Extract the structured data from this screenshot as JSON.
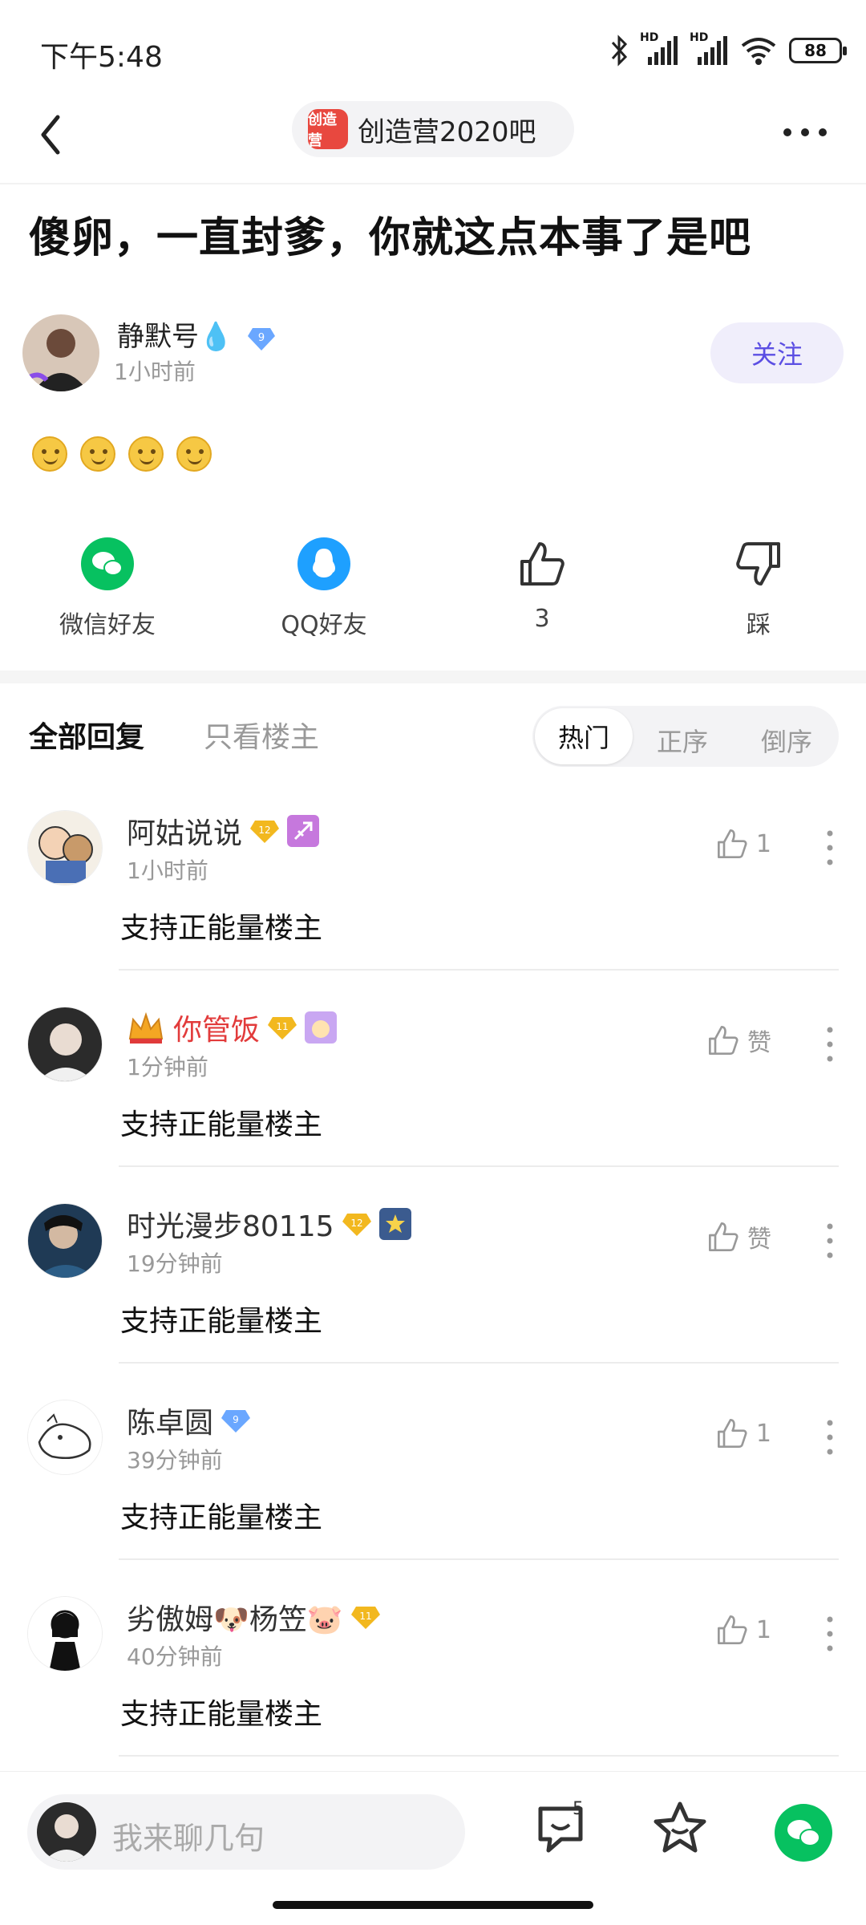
{
  "status_bar": {
    "time": "下午5:48",
    "battery": "88",
    "net1": "HD",
    "net2": "HD"
  },
  "nav": {
    "forum_name": "创造营2020吧",
    "forum_logo_text": "创造营"
  },
  "post": {
    "title": "傻卵，一直封爹，你就这点本事了是吧",
    "author": {
      "name": "静默号💧",
      "level": "9",
      "time": "1小时前"
    },
    "follow_label": "关注"
  },
  "actions": {
    "wechat": "微信好友",
    "qq": "QQ好友",
    "like_count": "3",
    "dislike": "踩"
  },
  "reply_tabs": {
    "all": "全部回复",
    "op_only": "只看楼主",
    "sort": {
      "hot": "热门",
      "asc": "正序",
      "desc": "倒序"
    }
  },
  "comments": [
    {
      "name": "阿姑说说",
      "level": "12",
      "time": "1小时前",
      "text": "支持正能量楼主",
      "likes": "1"
    },
    {
      "name": "你管饭",
      "level": "11",
      "time": "1分钟前",
      "text": "支持正能量楼主",
      "likes": "赞"
    },
    {
      "name": "时光漫步80115",
      "level": "12",
      "time": "19分钟前",
      "text": "支持正能量楼主",
      "likes": "赞"
    },
    {
      "name": "陈卓圆",
      "level": "9",
      "time": "39分钟前",
      "text": "支持正能量楼主",
      "likes": "1"
    },
    {
      "name": "劣傲姆🐶杨笠🐷",
      "level": "11",
      "time": "40分钟前",
      "text": "支持正能量楼主",
      "likes": "1"
    }
  ],
  "bottom_bar": {
    "placeholder": "我来聊几句",
    "comment_count": "5"
  },
  "colors": {
    "accent": "#5b4ee3",
    "wechat": "#07c160",
    "qq": "#1ea0ff",
    "level_gold": "#f2b81f",
    "level_blue": "#6aa7ff",
    "vip_red": "#e23b3b"
  }
}
